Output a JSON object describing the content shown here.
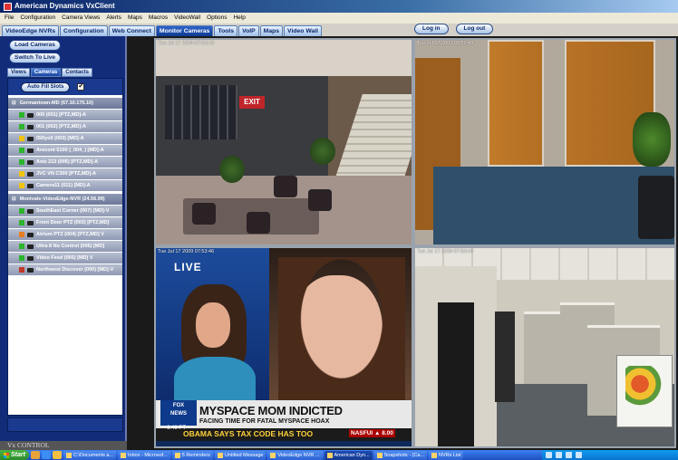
{
  "window": {
    "title": "American Dynamics VxClient"
  },
  "menu": [
    "File",
    "Configuration",
    "Camera Views",
    "Alerts",
    "Maps",
    "Macros",
    "VideoWall",
    "Options",
    "Help"
  ],
  "tabs": [
    {
      "label": "VideoEdge NVRs",
      "active": false
    },
    {
      "label": "Configuration",
      "active": false
    },
    {
      "label": "Web Connect",
      "active": false
    },
    {
      "label": "Monitor Cameras",
      "active": true
    },
    {
      "label": "Tools",
      "active": false
    },
    {
      "label": "VoIP",
      "active": false
    },
    {
      "label": "Maps",
      "active": false
    },
    {
      "label": "Video Wall",
      "active": false
    }
  ],
  "auth": {
    "login": "Log in",
    "logout": "Log out"
  },
  "left": {
    "load_cameras": "Load Cameras",
    "switch_live": "Switch To Live",
    "subtabs": [
      {
        "label": "Views",
        "active": false
      },
      {
        "label": "Cameras",
        "active": true
      },
      {
        "label": "Contacts",
        "active": false
      }
    ],
    "autofill": "Auto Fill Slots",
    "autofill_checked": "✔",
    "groups": [
      {
        "name": "Germantown-MD (67.10.175.10)",
        "cameras": [
          {
            "label": "000 (001) [PTZ,MD]-A",
            "status": "#2db52d"
          },
          {
            "label": "001 (002) [PTZ,MD]-A",
            "status": "#2db52d"
          },
          {
            "label": "ISRyo5 (003) [MD]-A",
            "status": "#f1c40f"
          },
          {
            "label": "Arecont 5100 (_004_) [MD]-A",
            "status": "#2db52d"
          },
          {
            "label": "Axis 213 (005) [PTZ,MD]-A",
            "status": "#2db52d"
          },
          {
            "label": "JVC VN C300 [PTZ,MD]-A",
            "status": "#f1c40f"
          },
          {
            "label": "Camera11 (011) [MD]-A",
            "status": "#f1c40f"
          }
        ]
      },
      {
        "name": "Montvale-VideoEdge-NVR (24.56.99)",
        "cameras": [
          {
            "label": "SouthEast Corner (007) [MD]-V",
            "status": "#2db52d"
          },
          {
            "label": "Front Door PTZ (003) [PTZ,MD]",
            "status": "#2db52d"
          },
          {
            "label": "Atrium PTZ (004) [PTZ,MD] V",
            "status": "#e67e22"
          },
          {
            "label": "Ultra 8 No Control (006) [MD]",
            "status": "#2db52d"
          },
          {
            "label": "Video Feed (005) [MD] V",
            "status": "#2db52d"
          },
          {
            "label": "Northwest Discover (000) [MD]-V",
            "status": "#c0392b"
          }
        ]
      }
    ],
    "footer": "Vx CONTROL"
  },
  "tiles": [
    {
      "timestamp": "Tue Jul 17 2009 07:53:43"
    },
    {
      "timestamp": "Tue Jul 17 2009 07:53:43"
    },
    {
      "timestamp": "Tue Jul 17 2009 07:53:46"
    },
    {
      "timestamp": "Tue Jul 17 2009 07:53:46"
    }
  ],
  "news": {
    "live": "LIVE",
    "logo_line1": "FOX",
    "logo_line2": "NEWS",
    "headline": "MYSPACE MOM INDICTED",
    "subhead": "FACING TIME FOR FATAL MYSPACE HOAX",
    "time": "6:49 PT",
    "ticker": "OBAMA SAYS TAX CODE HAS TOO",
    "nasdaq": "NASFUI ▲ 8.00"
  },
  "colors": {
    "accent": "#122c7a",
    "active_tab": "#0e3a92"
  },
  "taskbar": {
    "start": "Start",
    "tasks": [
      {
        "label": "C:\\Documents a...",
        "active": false
      },
      {
        "label": "Inbox - Microsof...",
        "active": false
      },
      {
        "label": "5 Reminders",
        "active": false
      },
      {
        "label": "Untitled Message",
        "active": false
      },
      {
        "label": "VideoEdge NVR ...",
        "active": false
      },
      {
        "label": "American Dyn...",
        "active": true
      },
      {
        "label": "Snapshots - (Ca...",
        "active": false
      },
      {
        "label": "NVRs List",
        "active": false
      }
    ]
  }
}
